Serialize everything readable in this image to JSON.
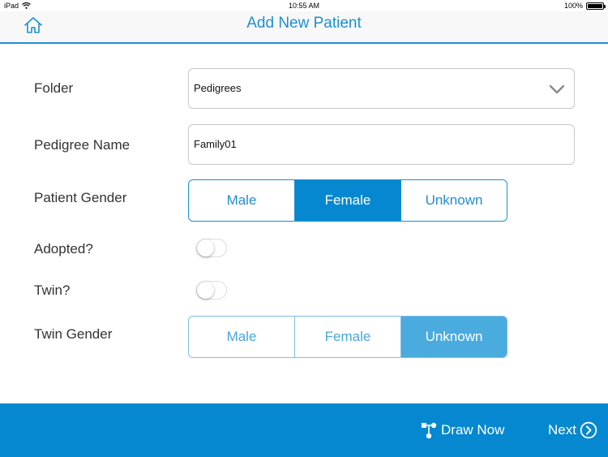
{
  "status_bar": {
    "device": "iPad",
    "time": "10:55 AM",
    "battery": "100%"
  },
  "nav": {
    "title": "Add New Patient",
    "home_icon": "home-icon"
  },
  "form": {
    "folder": {
      "label": "Folder",
      "value": "Pedigrees"
    },
    "pedigree_name": {
      "label": "Pedigree Name",
      "value": "Family01"
    },
    "patient_gender": {
      "label": "Patient Gender",
      "options": [
        "Male",
        "Female",
        "Unknown"
      ],
      "selected": "Female"
    },
    "adopted": {
      "label": "Adopted?",
      "on": false
    },
    "twin": {
      "label": "Twin?",
      "on": false
    },
    "twin_gender": {
      "label": "Twin Gender",
      "options": [
        "Male",
        "Female",
        "Unknown"
      ],
      "selected": "Unknown",
      "enabled": false
    }
  },
  "bottom_bar": {
    "draw_now": "Draw Now",
    "next": "Next"
  },
  "colors": {
    "accent": "#1e8fd0",
    "bottom_bar": "#0588cf",
    "segment_active": "#0588cf",
    "segment_disabled_active": "#4aabdf"
  }
}
